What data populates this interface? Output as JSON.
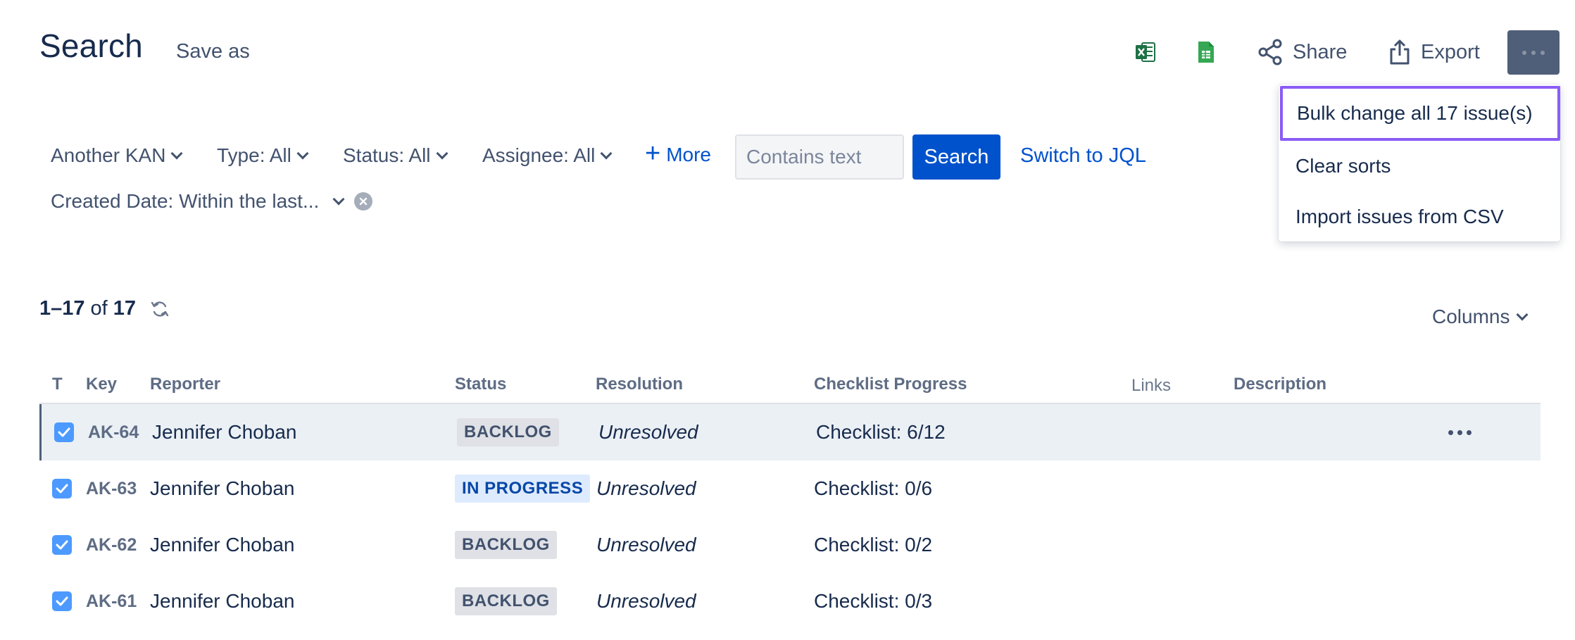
{
  "header": {
    "title": "Search",
    "save_as": "Save as",
    "share": "Share",
    "export": "Export"
  },
  "menu": {
    "items": [
      {
        "label": "Bulk change all 17 issue(s)"
      },
      {
        "label": "Clear sorts"
      },
      {
        "label": "Import issues from CSV"
      }
    ]
  },
  "filters": {
    "project": "Another KAN",
    "type": "Type: All",
    "status": "Status: All",
    "assignee": "Assignee: All",
    "more": "More",
    "text_placeholder": "Contains text",
    "text_value": "",
    "search": "Search",
    "switch_jql": "Switch to JQL",
    "created": "Created Date: Within the last..."
  },
  "results": {
    "range": "1–17",
    "of": "of",
    "total": "17",
    "columns": "Columns"
  },
  "table": {
    "headers": [
      "T",
      "Key",
      "Reporter",
      "Status",
      "Resolution",
      "Checklist Progress",
      "Links",
      "Description"
    ],
    "rows": [
      {
        "key": "AK-64",
        "reporter": "Jennifer Choban",
        "status": "BACKLOG",
        "resolution": "Unresolved",
        "checklist": "Checklist: 6/12"
      },
      {
        "key": "AK-63",
        "reporter": "Jennifer Choban",
        "status": "IN PROGRESS",
        "resolution": "Unresolved",
        "checklist": "Checklist: 0/6"
      },
      {
        "key": "AK-62",
        "reporter": "Jennifer Choban",
        "status": "BACKLOG",
        "resolution": "Unresolved",
        "checklist": "Checklist: 0/2"
      },
      {
        "key": "AK-61",
        "reporter": "Jennifer Choban",
        "status": "BACKLOG",
        "resolution": "Unresolved",
        "checklist": "Checklist: 0/3"
      }
    ]
  },
  "icons": {
    "excel": "excel-icon",
    "sheets": "google-sheets-icon",
    "share": "share-icon",
    "export": "export-icon",
    "more": "more-icon",
    "refresh": "refresh-icon",
    "clear": "clear-icon"
  },
  "colors": {
    "primary": "#0052cc",
    "focus_ring": "#8b5cf6",
    "more_button": "#505f79",
    "checkbox": "#4c9aff",
    "selected_row": "#ebf0f5"
  }
}
